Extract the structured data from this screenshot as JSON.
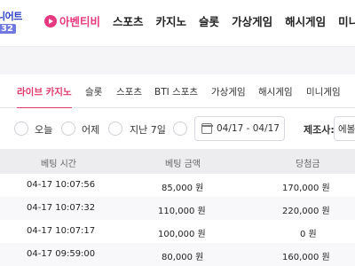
{
  "logo": {
    "line1": "니어트",
    "line2": "32"
  },
  "nav": {
    "items": [
      "아벤티비",
      "스포츠",
      "카지노",
      "슬롯",
      "가상게임",
      "해시게임",
      "미니"
    ]
  },
  "subtabs": [
    "라이브 카지노",
    "슬롯",
    "스포츠",
    "BTI 스포츠",
    "가상게임",
    "해시게임",
    "미니게임"
  ],
  "filters": {
    "options": [
      "오늘",
      "어제",
      "지난 7일"
    ],
    "date_range": "04/17 - 04/17",
    "maker_label": "제조사:",
    "maker_value": "에볼"
  },
  "table": {
    "headers": [
      "베팅 시간",
      "베팅 금액",
      "당첨금"
    ],
    "rows": [
      {
        "time": "04-17 10:07:56",
        "bet": "85,000 원",
        "win": "170,000 원"
      },
      {
        "time": "04-17 10:07:32",
        "bet": "110,000 원",
        "win": "220,000 원"
      },
      {
        "time": "04-17 10:07:17",
        "bet": "100,000 원",
        "win": "0 원"
      },
      {
        "time": "04-17 09:59:00",
        "bet": "80,000 원",
        "win": "160,000 원"
      }
    ]
  },
  "colors": {
    "accent": "#e03a6b",
    "live": "#e6397f",
    "logo": "#2c3fc4"
  }
}
